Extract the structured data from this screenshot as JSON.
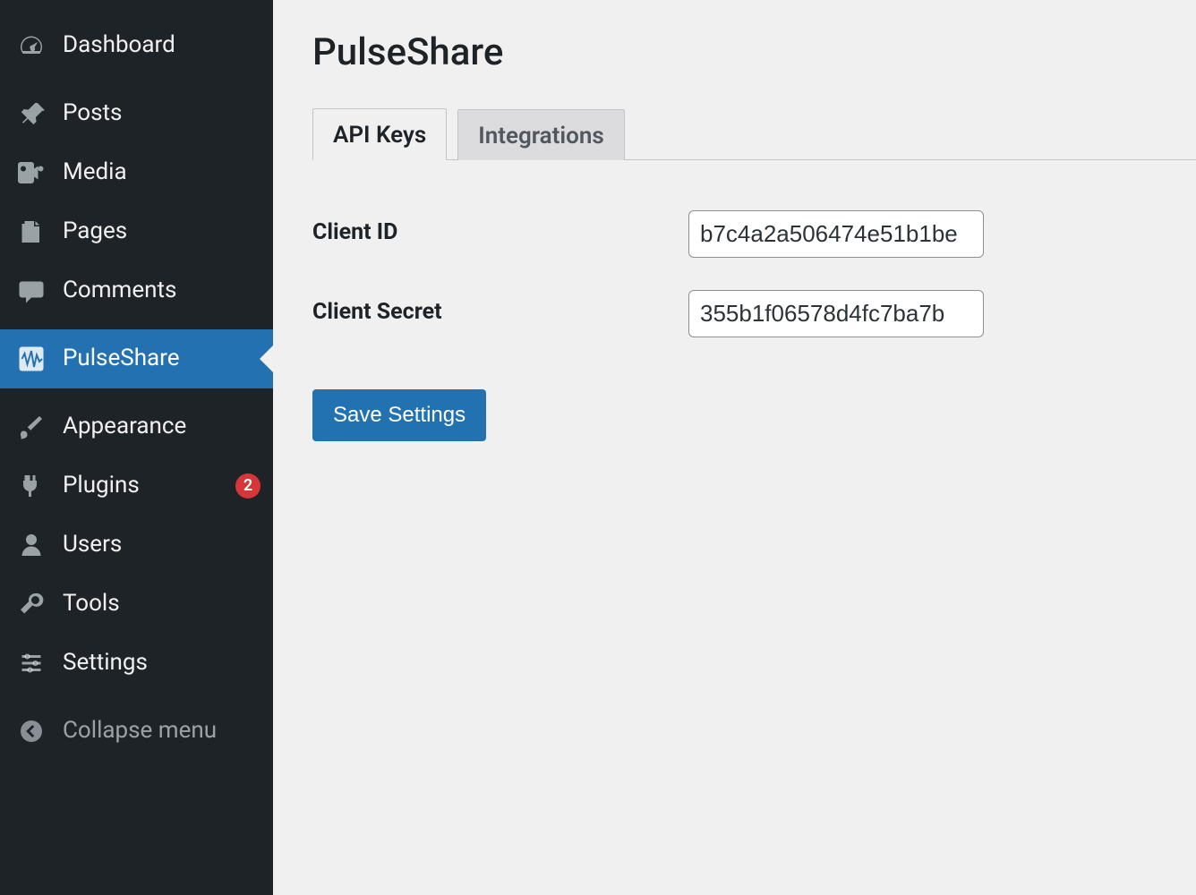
{
  "sidebar": {
    "items": [
      {
        "id": "dashboard",
        "label": "Dashboard"
      },
      {
        "id": "posts",
        "label": "Posts"
      },
      {
        "id": "media",
        "label": "Media"
      },
      {
        "id": "pages",
        "label": "Pages"
      },
      {
        "id": "comments",
        "label": "Comments"
      },
      {
        "id": "pulseshare",
        "label": "PulseShare"
      },
      {
        "id": "appearance",
        "label": "Appearance"
      },
      {
        "id": "plugins",
        "label": "Plugins",
        "badge": "2"
      },
      {
        "id": "users",
        "label": "Users"
      },
      {
        "id": "tools",
        "label": "Tools"
      },
      {
        "id": "settings",
        "label": "Settings"
      }
    ],
    "collapse_label": "Collapse menu"
  },
  "main": {
    "title": "PulseShare",
    "tabs": [
      {
        "id": "api-keys",
        "label": "API Keys",
        "active": true
      },
      {
        "id": "integrations",
        "label": "Integrations",
        "active": false
      }
    ],
    "fields": {
      "client_id": {
        "label": "Client ID",
        "value": "b7c4a2a506474e51b1be"
      },
      "client_secret": {
        "label": "Client Secret",
        "value": "355b1f06578d4fc7ba7b"
      }
    },
    "save_label": "Save Settings"
  }
}
